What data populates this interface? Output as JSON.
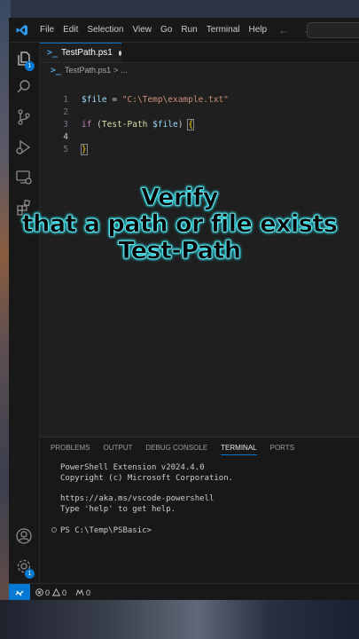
{
  "menu": [
    "File",
    "Edit",
    "Selection",
    "View",
    "Go",
    "Run",
    "Terminal",
    "Help"
  ],
  "nav_arrows": "← →",
  "activity": {
    "explorer_badge": "1",
    "settings_badge": "1"
  },
  "tab": {
    "label": "TestPath.ps1"
  },
  "breadcrumb": {
    "file": "TestPath.ps1",
    "sep": ">",
    "rest": "..."
  },
  "editor": {
    "lines": [
      {
        "num": "1",
        "parts": [
          [
            "$file",
            "var"
          ],
          [
            " = ",
            "op"
          ],
          [
            "\"C:\\Temp\\example.txt\"",
            "str"
          ]
        ]
      },
      {
        "num": "2",
        "parts": []
      },
      {
        "num": "3",
        "parts": [
          [
            "if",
            "kw"
          ],
          [
            " (",
            "op"
          ],
          [
            "Test-Path",
            "fn"
          ],
          [
            " ",
            "op"
          ],
          [
            "$file",
            "var"
          ],
          [
            ") ",
            "op"
          ],
          [
            "{",
            "brace"
          ]
        ]
      },
      {
        "num": "4",
        "parts": []
      },
      {
        "num": "5",
        "parts": [
          [
            "}",
            "brace"
          ]
        ]
      }
    ]
  },
  "caption": {
    "line1": "Verify",
    "line2": "that a path or file exists",
    "line3": "Test-Path"
  },
  "panel": {
    "tabs": [
      "PROBLEMS",
      "OUTPUT",
      "DEBUG CONSOLE",
      "TERMINAL",
      "PORTS"
    ],
    "active_tab": "TERMINAL",
    "terminal": {
      "line1": "PowerShell Extension v2024.4.0",
      "line2": "Copyright (c) Microsoft Corporation.",
      "line3": "https://aka.ms/vscode-powershell",
      "line4": "Type 'help' to get help.",
      "prompt": "PS C:\\Temp\\PSBasic>"
    }
  },
  "status": {
    "errors": "0",
    "warnings": "0",
    "ports": "0"
  },
  "colors": {
    "accent": "#0078d4",
    "caption_glow": "#35f0ff"
  }
}
